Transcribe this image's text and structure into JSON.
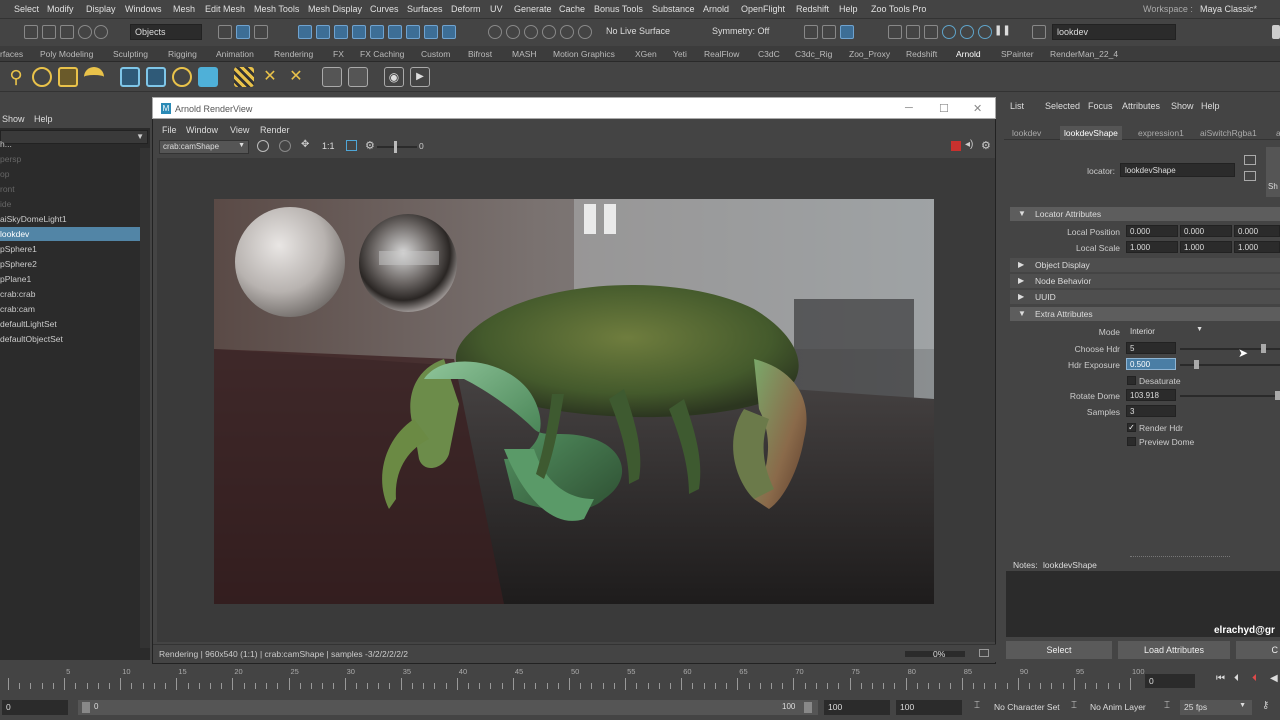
{
  "menubar": {
    "items": [
      "Select",
      "Modify",
      "Display",
      "Windows",
      "Mesh",
      "Edit Mesh",
      "Mesh Tools",
      "Mesh Display",
      "Curves",
      "Surfaces",
      "Deform",
      "UV",
      "Generate",
      "Cache",
      "Bonus Tools",
      "Substance",
      "Arnold",
      "OpenFlight",
      "Redshift",
      "Help",
      "Zoo Tools Pro"
    ],
    "workspace_label": "Workspace :",
    "workspace_value": "Maya Classic*"
  },
  "toolbar": {
    "objects_field": "Objects",
    "live_surface": "No Live Surface",
    "symmetry": "Symmetry: Off",
    "search_value": "lookdev"
  },
  "shelf_tabs": [
    "rfaces",
    "Poly Modeling",
    "Sculpting",
    "Rigging",
    "Animation",
    "Rendering",
    "FX",
    "FX Caching",
    "Custom",
    "Bifrost",
    "MASH",
    "Motion Graphics",
    "XGen",
    "Yeti",
    "RealFlow",
    "C3dC",
    "C3dc_Rig",
    "Zoo_Proxy",
    "Redshift",
    "Arnold",
    "SPainter",
    "RenderMan_22_4"
  ],
  "shelf_active": "Arnold",
  "outliner": {
    "menu": [
      "Show",
      "Help"
    ],
    "items": [
      {
        "label": "h...",
        "state": "normal"
      },
      {
        "label": "persp",
        "state": "dim"
      },
      {
        "label": "op",
        "state": "dim"
      },
      {
        "label": "ront",
        "state": "dim"
      },
      {
        "label": "ide",
        "state": "dim"
      },
      {
        "label": "aiSkyDomeLight1",
        "state": "normal"
      },
      {
        "label": "lookdev",
        "state": "sel"
      },
      {
        "label": "pSphere1",
        "state": "normal"
      },
      {
        "label": "pSphere2",
        "state": "normal"
      },
      {
        "label": "pPlane1",
        "state": "normal"
      },
      {
        "label": "crab:crab",
        "state": "normal"
      },
      {
        "label": "crab:cam",
        "state": "normal"
      },
      {
        "label": "defaultLightSet",
        "state": "normal"
      },
      {
        "label": "defaultObjectSet",
        "state": "normal"
      }
    ]
  },
  "renderview": {
    "title": "Arnold RenderView",
    "menu": [
      "File",
      "Window",
      "View",
      "Render"
    ],
    "camera": "crab:camShape",
    "ratio": "1:1",
    "exposure": "0",
    "status": "Rendering | 960x540 (1:1) | crab:camShape | samples -3/2/2/2/2/2",
    "progress": "0%"
  },
  "attribute_editor": {
    "menu": [
      "List",
      "Selected",
      "Focus",
      "Attributes",
      "Show",
      "Help"
    ],
    "tabs": [
      "lookdev",
      "lookdevShape",
      "expression1",
      "aiSwitchRgba1",
      "a"
    ],
    "active_tab": "lookdevShape",
    "node_label": "locator:",
    "node_name": "lookdevShape",
    "side_label": "Sh",
    "sections": {
      "locator": "Locator Attributes",
      "object_display": "Object Display",
      "node_behavior": "Node Behavior",
      "uuid": "UUID",
      "extra": "Extra Attributes"
    },
    "local_position_label": "Local Position",
    "local_position": [
      "0.000",
      "0.000",
      "0.000"
    ],
    "local_scale_label": "Local Scale",
    "local_scale": [
      "1.000",
      "1.000",
      "1.000"
    ],
    "mode_label": "Mode",
    "mode_value": "Interior",
    "choose_hdr_label": "Choose Hdr",
    "choose_hdr_value": "5",
    "hdr_exposure_label": "Hdr Exposure",
    "hdr_exposure_value": "0.500",
    "desaturate_label": "Desaturate",
    "rotate_dome_label": "Rotate Dome",
    "rotate_dome_value": "103.918",
    "samples_label": "Samples",
    "samples_value": "3",
    "render_hdr_label": "Render Hdr",
    "preview_dome_label": "Preview Dome",
    "notes_label": "Notes:",
    "notes_value": "lookdevShape",
    "watermark": "elrachyd@gr",
    "btn_select": "Select",
    "btn_load": "Load Attributes",
    "btn_copy": "C"
  },
  "timeline": {
    "ticks": [
      "5",
      "10",
      "15",
      "20",
      "25",
      "30",
      "35",
      "40",
      "45",
      "50",
      "55",
      "60",
      "65",
      "70",
      "75",
      "80",
      "85",
      "90",
      "95",
      "100"
    ],
    "current_frame": "0"
  },
  "range": {
    "start": "0",
    "inner_start": "0",
    "inner_end": "100",
    "end1": "100",
    "end2": "100",
    "character_set": "No Character Set",
    "anim_layer": "No Anim Layer",
    "fps": "25 fps"
  },
  "colors": {
    "selection": "#5285a6",
    "highlight": "#4a7ea5",
    "record": "#c8312e"
  }
}
